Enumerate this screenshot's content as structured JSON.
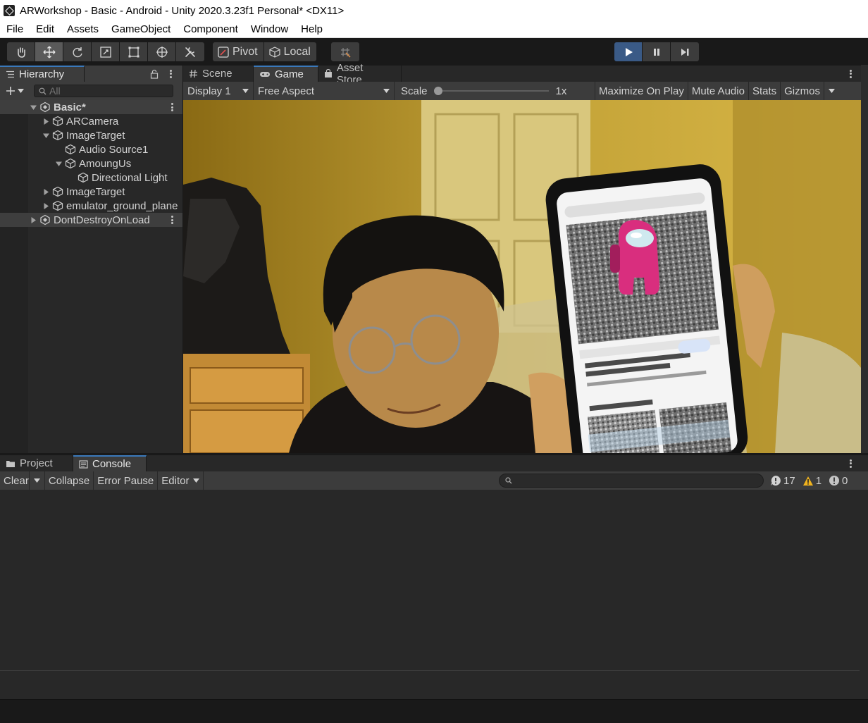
{
  "window": {
    "title": "ARWorkshop - Basic - Android - Unity 2020.3.23f1 Personal* <DX11>"
  },
  "menu": [
    "File",
    "Edit",
    "Assets",
    "GameObject",
    "Component",
    "Window",
    "Help"
  ],
  "toolbar": {
    "tools": [
      "hand-tool",
      "move-tool",
      "rotate-tool",
      "scale-tool",
      "rect-tool",
      "transform-tool",
      "custom-tool"
    ],
    "active_tool_index": 1,
    "pivot_label": "Pivot",
    "local_label": "Local",
    "play_active": true
  },
  "hierarchy": {
    "tab_label": "Hierarchy",
    "search_placeholder": "All",
    "items": [
      {
        "label": "Basic*",
        "depth": 0,
        "scene": true,
        "expanded": true
      },
      {
        "label": "ARCamera",
        "depth": 1,
        "expanded": false,
        "has_children": true
      },
      {
        "label": "ImageTarget",
        "depth": 1,
        "expanded": true,
        "has_children": true
      },
      {
        "label": "Audio Source1",
        "depth": 2,
        "has_children": false
      },
      {
        "label": "AmoungUs",
        "depth": 2,
        "expanded": true,
        "has_children": true
      },
      {
        "label": "Directional Light",
        "depth": 3,
        "has_children": false
      },
      {
        "label": "ImageTarget",
        "depth": 1,
        "expanded": false,
        "has_children": true
      },
      {
        "label": "emulator_ground_plane",
        "depth": 1,
        "expanded": false,
        "has_children": true
      },
      {
        "label": "DontDestroyOnLoad",
        "depth": 0,
        "scene": true,
        "expanded": false
      }
    ]
  },
  "game_view": {
    "tabs": [
      {
        "label": "Scene",
        "icon": "hash-icon",
        "selected": false
      },
      {
        "label": "Game",
        "icon": "gamepad-icon",
        "selected": true
      },
      {
        "label": "Asset Store",
        "icon": "store-icon",
        "selected": false
      }
    ],
    "display": "Display 1",
    "aspect": "Free Aspect",
    "scale_label": "Scale",
    "scale_value": "1x",
    "maximize_label": "Maximize On Play",
    "mute_label": "Mute Audio",
    "stats_label": "Stats",
    "gizmos_label": "Gizmos"
  },
  "console": {
    "tabs": [
      {
        "label": "Project",
        "icon": "folder-icon",
        "selected": false
      },
      {
        "label": "Console",
        "icon": "console-icon",
        "selected": true
      }
    ],
    "clear_label": "Clear",
    "collapse_label": "Collapse",
    "error_pause_label": "Error Pause",
    "editor_label": "Editor",
    "log_count": "17",
    "warning_count": "1",
    "error_count": "0"
  },
  "colors": {
    "accent": "#3a79bb",
    "play": "#3a5a86",
    "warning": "#f0b31e"
  }
}
